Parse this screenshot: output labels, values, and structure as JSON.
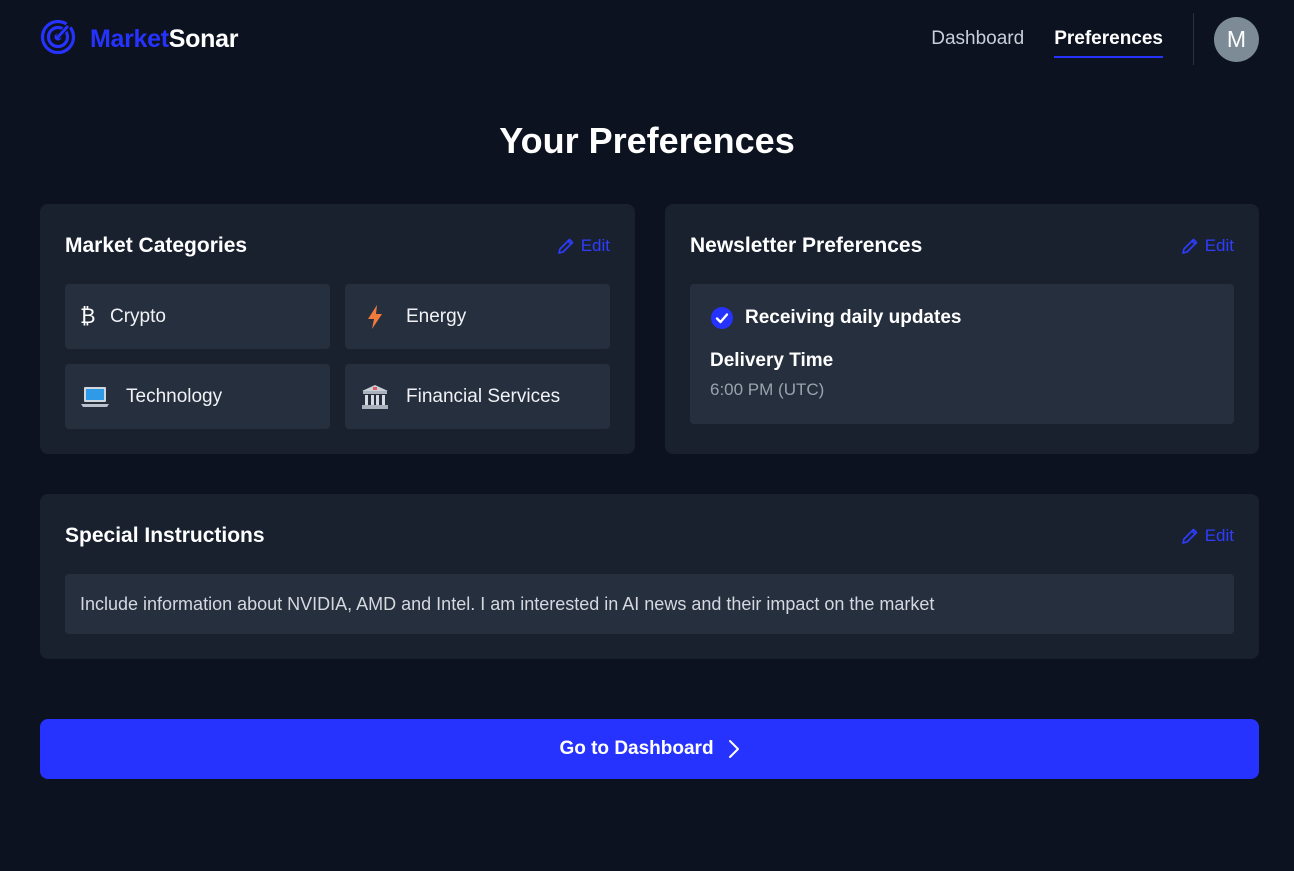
{
  "brand": {
    "name_part1": "Market",
    "name_part2": "Sonar",
    "accent": "#2633ff"
  },
  "nav": {
    "items": [
      {
        "label": "Dashboard",
        "active": false
      },
      {
        "label": "Preferences",
        "active": true
      }
    ],
    "avatar_initial": "M"
  },
  "page": {
    "title": "Your Preferences"
  },
  "market_categories": {
    "title": "Market Categories",
    "edit_label": "Edit",
    "items": [
      {
        "label": "Crypto",
        "icon": "bitcoin-icon"
      },
      {
        "label": "Energy",
        "icon": "lightning-icon"
      },
      {
        "label": "Technology",
        "icon": "laptop-icon"
      },
      {
        "label": "Financial Services",
        "icon": "bank-icon"
      }
    ]
  },
  "newsletter": {
    "title": "Newsletter Preferences",
    "edit_label": "Edit",
    "status": "Receiving daily updates",
    "delivery_label": "Delivery Time",
    "delivery_value": "6:00 PM (UTC)"
  },
  "special_instructions": {
    "title": "Special Instructions",
    "edit_label": "Edit",
    "text": "Include information about NVIDIA, AMD and Intel. I am interested in AI news and their impact on the market"
  },
  "cta": {
    "label": "Go to Dashboard"
  }
}
